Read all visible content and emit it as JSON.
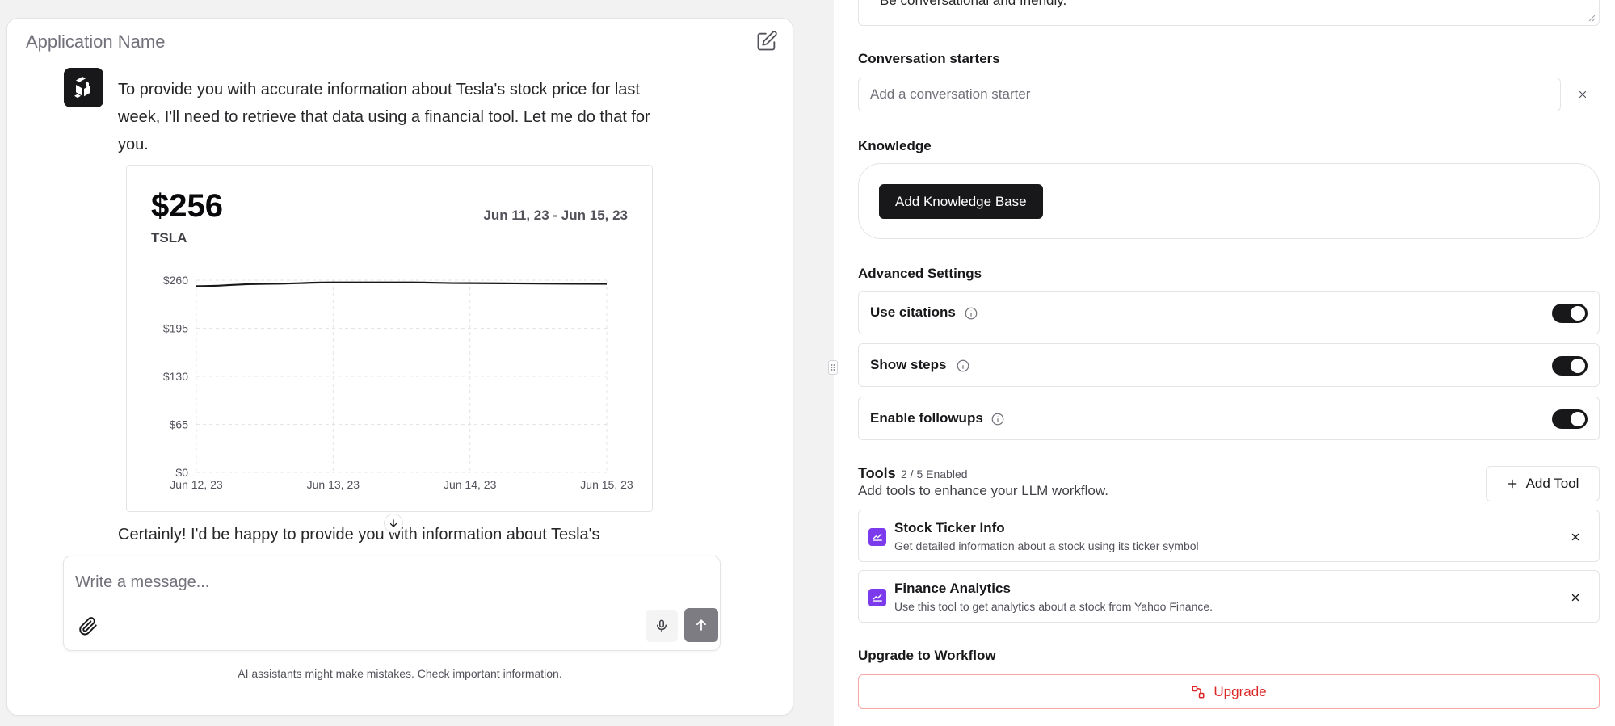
{
  "app": {
    "title": "Application Name"
  },
  "chat": {
    "assistant_message": "To provide you with accurate information about Tesla's stock price for last week, I'll need to retrieve that data using a financial tool. Let me do that for you.",
    "assistant_message_2": "Certainly! I'd be happy to provide you with information about Tesla's",
    "stock_card": {
      "price": "$256",
      "ticker": "TSLA",
      "date_range": "Jun 11, 23 - Jun 15, 23"
    },
    "composer_placeholder": "Write a message...",
    "disclaimer": "AI assistants might make mistakes. Check important information."
  },
  "chart_data": {
    "type": "line",
    "title": "",
    "x": [
      "Jun 12, 23",
      "Jun 13, 23",
      "Jun 14, 23",
      "Jun 15, 23"
    ],
    "y_ticks": [
      "$0",
      "$65",
      "$130",
      "$195",
      "$260"
    ],
    "ylim": [
      0,
      260
    ],
    "grid": true,
    "series": [
      {
        "values": [
          [
            0,
            252
          ],
          [
            0.5,
            255
          ],
          [
            1,
            257
          ],
          [
            1.5,
            257
          ],
          [
            2,
            256
          ],
          [
            2.5,
            255.5
          ],
          [
            3,
            255
          ]
        ]
      }
    ],
    "color": "#18181b"
  },
  "config": {
    "prev_textarea_text": "Be conversational and friendly.",
    "conversation_starters_label": "Conversation starters",
    "starter_placeholder": "Add a conversation starter",
    "knowledge_label": "Knowledge",
    "add_knowledge_label": "Add Knowledge Base",
    "advanced_label": "Advanced Settings",
    "toggles": [
      {
        "label": "Use citations",
        "on": true
      },
      {
        "label": "Show steps",
        "on": true
      },
      {
        "label": "Enable followups",
        "on": true
      }
    ],
    "tools_title": "Tools",
    "tools_count": "2 / 5 Enabled",
    "tools_desc": "Add tools to enhance your LLM workflow.",
    "add_tool_label": "Add Tool",
    "tools": [
      {
        "name": "Stock Ticker Info",
        "desc": "Get detailed information about a stock using its ticker symbol"
      },
      {
        "name": "Finance Analytics",
        "desc": "Use this tool to get analytics about a stock from Yahoo Finance."
      }
    ],
    "upgrade_section_label": "Upgrade to Workflow",
    "upgrade_label": "Upgrade"
  },
  "colors": {
    "accent": "#18181b",
    "tool_icon": "#7c3aed",
    "danger": "#dc2626"
  }
}
